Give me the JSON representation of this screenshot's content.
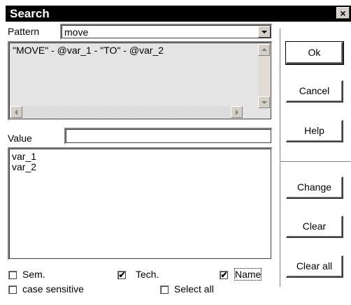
{
  "window": {
    "title": "Search",
    "close_glyph": "×"
  },
  "pattern": {
    "label": "Pattern",
    "value": "move",
    "expression": "\"MOVE\" - @var_1 - \"TO\" - @var_2"
  },
  "value_field": {
    "label": "Value",
    "value": ""
  },
  "variables": [
    "var_1",
    "var_2"
  ],
  "buttons": {
    "ok": "Ok",
    "cancel": "Cancel",
    "help": "Help",
    "change": "Change",
    "clear": "Clear",
    "clear_all": "Clear all"
  },
  "options": [
    {
      "label": "Sem.",
      "checked": false
    },
    {
      "label": "Tech.",
      "checked": true
    },
    {
      "label": "Name",
      "checked": true
    },
    {
      "label": "case sensitive",
      "checked": false
    },
    {
      "label": "Select all",
      "checked": false
    }
  ],
  "icons": {
    "close": "close-icon",
    "dropdown": "chevron-down-icon",
    "scroll_up": "arrow-up-icon",
    "scroll_down": "arrow-down-icon",
    "scroll_left": "arrow-left-icon",
    "scroll_right": "arrow-right-icon",
    "check": "checkmark-icon"
  },
  "colors": {
    "titlebar": "#000000",
    "face": "#d4d0c8",
    "text": "#000000"
  }
}
